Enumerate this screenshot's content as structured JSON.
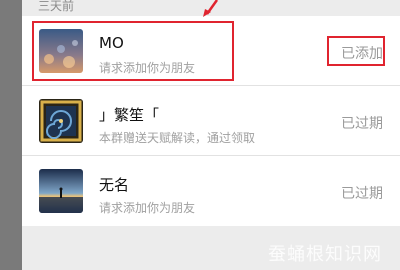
{
  "section_header": "三天前",
  "requests": [
    {
      "name": "MO",
      "message": "请求添加你为朋友",
      "status": "已添加",
      "avatar_icon": "bokeh-photo-avatar"
    },
    {
      "name": "」繁笙「",
      "message": "本群赠送天赋解读，通过领取",
      "status": "已过期",
      "avatar_icon": "swirl-frame-avatar"
    },
    {
      "name": "无名",
      "message": "请求添加你为朋友",
      "status": "已过期",
      "avatar_icon": "sunset-silhouette-avatar"
    }
  ],
  "watermark": "蚕蛹根知识网",
  "colors": {
    "highlight": "#e0242f",
    "page_background": "#ececec"
  }
}
